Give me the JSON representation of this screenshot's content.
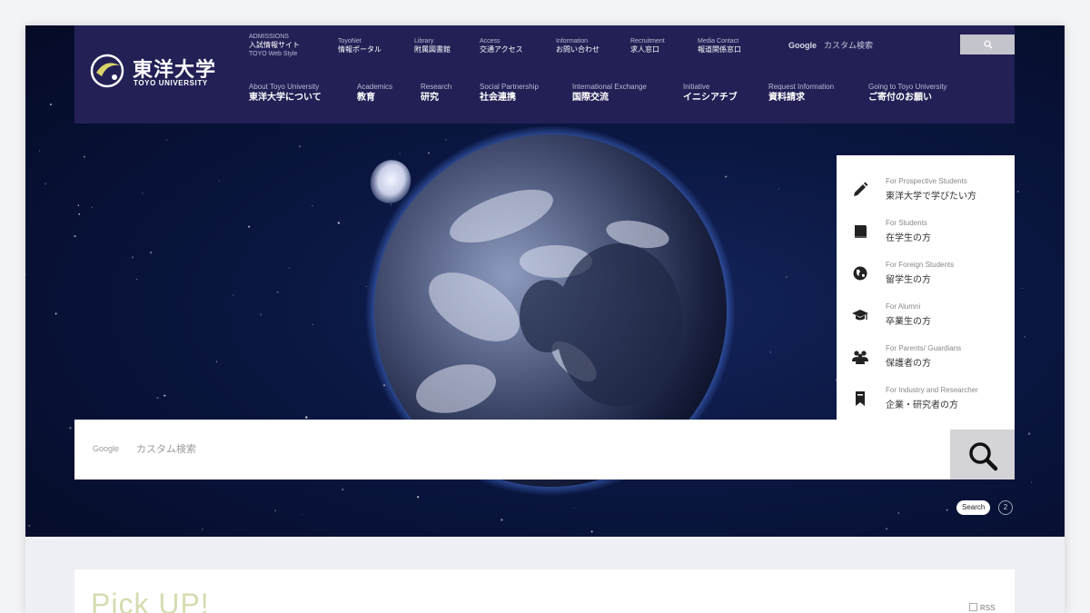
{
  "brand": {
    "name_jp": "東洋大学",
    "name_en": "TOYO UNIVERSITY"
  },
  "header": {
    "top_links": [
      {
        "en": "ADMISSIONS",
        "jp": "入試情報サイト",
        "sub": "TOYO Web Style"
      },
      {
        "en": "ToyoNet",
        "jp": "情報ポータル"
      },
      {
        "en": "Library",
        "jp": "附属図書館"
      },
      {
        "en": "Access",
        "jp": "交通アクセス"
      },
      {
        "en": "Information",
        "jp": "お問い合わせ"
      },
      {
        "en": "Recruitment",
        "jp": "求人窓口"
      },
      {
        "en": "Media Contact",
        "jp": "報道関係窓口"
      }
    ],
    "main_links": [
      {
        "en": "About Toyo University",
        "jp": "東洋大学について"
      },
      {
        "en": "Academics",
        "jp": "教育"
      },
      {
        "en": "Research",
        "jp": "研究"
      },
      {
        "en": "Social Partnership",
        "jp": "社会連携"
      },
      {
        "en": "International Exchange",
        "jp": "国際交流"
      },
      {
        "en": "Initiative",
        "jp": "イニシアチブ"
      },
      {
        "en": "Request Information",
        "jp": "資料請求"
      },
      {
        "en": "Going to Toyo University",
        "jp": "ご寄付のお願い"
      }
    ],
    "google_label": "Google",
    "search_placeholder": "カスタム検索"
  },
  "audience": [
    {
      "en": "For Prospective Students",
      "jp": "東洋大学で学びたい方",
      "icon": "pencil-icon"
    },
    {
      "en": "For Students",
      "jp": "在学生の方",
      "icon": "book-icon"
    },
    {
      "en": "For Foreign Students",
      "jp": "留学生の方",
      "icon": "globe-icon"
    },
    {
      "en": "For Alumni",
      "jp": "卒業生の方",
      "icon": "graduation-cap-icon"
    },
    {
      "en": "For Parents/ Guardians",
      "jp": "保護者の方",
      "icon": "people-icon"
    },
    {
      "en": "For Industry and Researcher",
      "jp": "企業・研究者の方",
      "icon": "bookmark-icon"
    }
  ],
  "search": {
    "google_label": "Google",
    "placeholder": "カスタム検索"
  },
  "hero_controls": {
    "search_label": "Search",
    "page_number": "2"
  },
  "pickup": {
    "title": "Pick UP!",
    "rss_label": "RSS"
  },
  "colors": {
    "header_bg": "#232056",
    "hero_bg": "#0a1640",
    "panel_bg": "#ffffff",
    "accent_title": "#d7dbb0"
  }
}
